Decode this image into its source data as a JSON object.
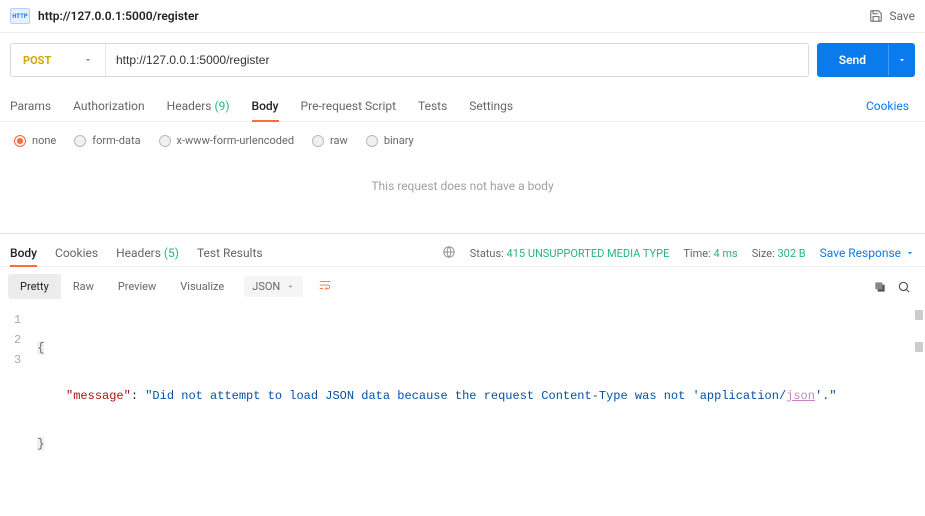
{
  "topbar": {
    "title": "http://127.0.0.1:5000/register",
    "save_label": "Save"
  },
  "request": {
    "method": "POST",
    "url": "http://127.0.0.1:5000/register",
    "send_label": "Send"
  },
  "req_tabs": {
    "params": "Params",
    "auth": "Authorization",
    "headers": "Headers",
    "headers_count": "(9)",
    "body": "Body",
    "prerequest": "Pre-request Script",
    "tests": "Tests",
    "settings": "Settings",
    "cookies": "Cookies"
  },
  "body_types": {
    "none": "none",
    "formdata": "form-data",
    "urlencoded": "x-www-form-urlencoded",
    "raw": "raw",
    "binary": "binary"
  },
  "no_body": "This request does not have a body",
  "resp_tabs": {
    "body": "Body",
    "cookies": "Cookies",
    "headers": "Headers",
    "headers_count": "(5)",
    "test_results": "Test Results"
  },
  "resp_meta": {
    "status_label": "Status:",
    "status_val": "415 UNSUPPORTED MEDIA TYPE",
    "time_label": "Time:",
    "time_val": "4 ms",
    "size_label": "Size:",
    "size_val": "302 B",
    "save_response": "Save Response"
  },
  "views": {
    "pretty": "Pretty",
    "raw": "Raw",
    "preview": "Preview",
    "visualize": "Visualize",
    "format": "JSON"
  },
  "response_json": {
    "open": "{",
    "close": "}",
    "line2_key": "\"message\"",
    "line2_colon": ": ",
    "line2_val_pre": "\"Did not attempt to load JSON data because the request Content-Type was not 'application/",
    "line2_val_tok": "json",
    "line2_val_post": "'.\""
  },
  "lines": {
    "l1": "1",
    "l2": "2",
    "l3": "3"
  }
}
